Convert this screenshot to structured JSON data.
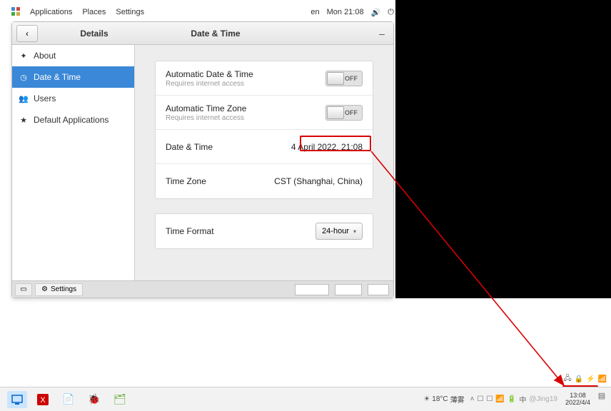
{
  "topbar": {
    "menu": [
      "Applications",
      "Places",
      "Settings"
    ],
    "lang": "en",
    "datetime": "Mon 21:08"
  },
  "window": {
    "title_left": "Details",
    "title_right": "Date & Time"
  },
  "sidebar": {
    "items": [
      {
        "icon": "✦",
        "label": "About"
      },
      {
        "icon": "◷",
        "label": "Date & Time"
      },
      {
        "icon": "👥",
        "label": "Users"
      },
      {
        "icon": "★",
        "label": "Default Applications"
      }
    ],
    "active_index": 1
  },
  "settings": {
    "auto_dt": {
      "title": "Automatic Date & Time",
      "sub": "Requires internet access",
      "state": "OFF"
    },
    "auto_tz": {
      "title": "Automatic Time Zone",
      "sub": "Requires internet access",
      "state": "OFF"
    },
    "dt": {
      "title": "Date & Time",
      "value": "4 April 2022, 21:08"
    },
    "tz": {
      "title": "Time Zone",
      "value": "CST (Shanghai, China)"
    },
    "fmt": {
      "title": "Time Format",
      "value": "24-hour"
    }
  },
  "footer": {
    "tab_label": "Settings"
  },
  "host_taskbar": {
    "weather_temp": "18°C",
    "weather_desc": "薄雾",
    "clock_time": "13:08",
    "clock_date": "2022/4/4"
  }
}
